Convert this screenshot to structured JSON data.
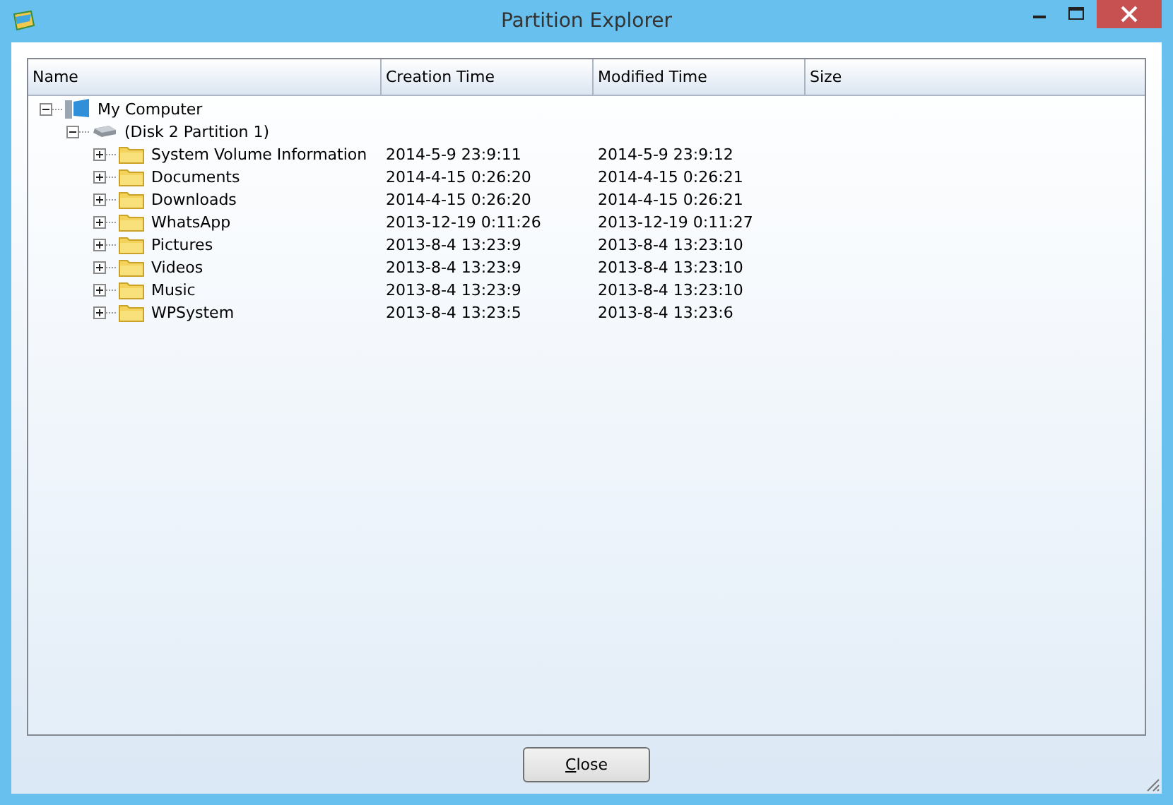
{
  "window": {
    "title": "Partition Explorer"
  },
  "table": {
    "columns": [
      "Name",
      "Creation Time",
      "Modified Time",
      "Size"
    ]
  },
  "tree": [
    {
      "kind": "computer",
      "name": "My Computer",
      "expanded": true,
      "children": [
        {
          "kind": "drive",
          "name": "(Disk 2 Partition 1)",
          "expanded": true,
          "children": [
            {
              "kind": "folder",
              "name": "System Volume Information",
              "created": "2014-5-9 23:9:11",
              "modified": "2014-5-9 23:9:12",
              "expanded": false
            },
            {
              "kind": "folder",
              "name": "Documents",
              "created": "2014-4-15 0:26:20",
              "modified": "2014-4-15 0:26:21",
              "expanded": false
            },
            {
              "kind": "folder",
              "name": "Downloads",
              "created": "2014-4-15 0:26:20",
              "modified": "2014-4-15 0:26:21",
              "expanded": false
            },
            {
              "kind": "folder",
              "name": "WhatsApp",
              "created": "2013-12-19 0:11:26",
              "modified": "2013-12-19 0:11:27",
              "expanded": false
            },
            {
              "kind": "folder",
              "name": "Pictures",
              "created": "2013-8-4 13:23:9",
              "modified": "2013-8-4 13:23:10",
              "expanded": false
            },
            {
              "kind": "folder",
              "name": "Videos",
              "created": "2013-8-4 13:23:9",
              "modified": "2013-8-4 13:23:10",
              "expanded": false
            },
            {
              "kind": "folder",
              "name": "Music",
              "created": "2013-8-4 13:23:9",
              "modified": "2013-8-4 13:23:10",
              "expanded": false
            },
            {
              "kind": "folder",
              "name": "WPSystem",
              "created": "2013-8-4 13:23:5",
              "modified": "2013-8-4 13:23:6",
              "expanded": false
            }
          ]
        }
      ]
    }
  ],
  "buttons": [
    {
      "label": "Close",
      "underline_first_letter": true
    }
  ]
}
